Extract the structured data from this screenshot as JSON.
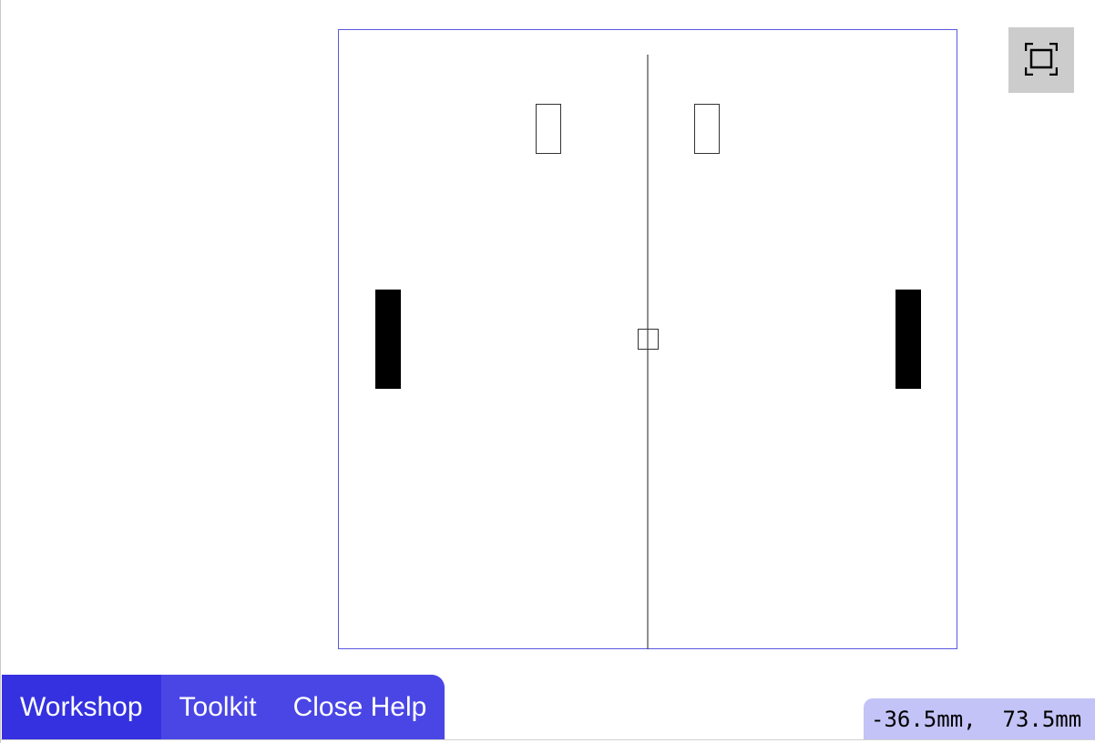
{
  "toolbar": {
    "fullscreen_icon": "fullscreen-icon"
  },
  "tabs": [
    {
      "label": "Workshop",
      "active": true
    },
    {
      "label": "Toolkit",
      "active": false
    },
    {
      "label": "Close Help",
      "active": false
    }
  ],
  "status": {
    "coordinates": "-36.5mm,  73.5mm"
  },
  "colors": {
    "canvas_border": "#5b57e0",
    "tab_bar": "#4a46e6",
    "tab_active": "#3531e0",
    "coords_background": "#c3c3f7",
    "fullscreen_button": "#cccccc"
  }
}
